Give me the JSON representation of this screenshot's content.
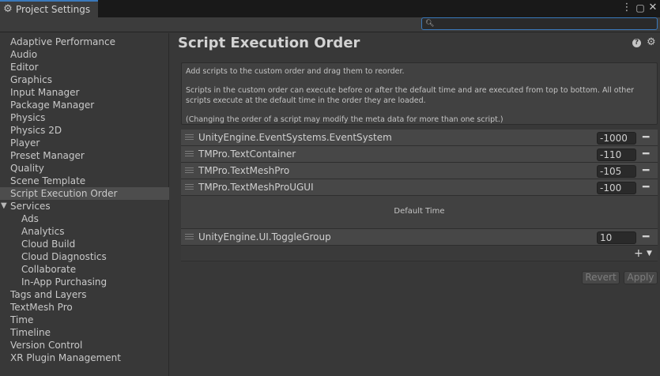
{
  "window": {
    "tab_title": "Project Settings",
    "controls": [
      "kebab-menu",
      "maximize",
      "close"
    ]
  },
  "search": {
    "value": "",
    "placeholder": ""
  },
  "sidebar": {
    "items": [
      {
        "label": "Adaptive Performance"
      },
      {
        "label": "Audio"
      },
      {
        "label": "Editor"
      },
      {
        "label": "Graphics"
      },
      {
        "label": "Input Manager"
      },
      {
        "label": "Package Manager"
      },
      {
        "label": "Physics"
      },
      {
        "label": "Physics 2D"
      },
      {
        "label": "Player"
      },
      {
        "label": "Preset Manager"
      },
      {
        "label": "Quality"
      },
      {
        "label": "Scene Template"
      },
      {
        "label": "Script Execution Order",
        "selected": true
      },
      {
        "label": "Services",
        "expanded": true
      },
      {
        "label": "Ads",
        "child": true
      },
      {
        "label": "Analytics",
        "child": true
      },
      {
        "label": "Cloud Build",
        "child": true
      },
      {
        "label": "Cloud Diagnostics",
        "child": true
      },
      {
        "label": "Collaborate",
        "child": true
      },
      {
        "label": "In-App Purchasing",
        "child": true
      },
      {
        "label": "Tags and Layers"
      },
      {
        "label": "TextMesh Pro"
      },
      {
        "label": "Time"
      },
      {
        "label": "Timeline"
      },
      {
        "label": "Version Control"
      },
      {
        "label": "XR Plugin Management"
      }
    ]
  },
  "main": {
    "title": "Script Execution Order",
    "info": {
      "line1": "Add scripts to the custom order and drag them to reorder.",
      "line2": "Scripts in the custom order can execute before or after the default time and are executed from top to bottom. All other scripts execute at the default time in the order they are loaded.",
      "line3": "(Changing the order of a script may modify the meta data for more than one script.)"
    },
    "scripts_before": [
      {
        "name": "UnityEngine.EventSystems.EventSystem",
        "order": "-1000"
      },
      {
        "name": "TMPro.TextContainer",
        "order": "-110"
      },
      {
        "name": "TMPro.TextMeshPro",
        "order": "-105"
      },
      {
        "name": "TMPro.TextMeshProUGUI",
        "order": "-100"
      }
    ],
    "default_time_label": "Default Time",
    "scripts_after": [
      {
        "name": "UnityEngine.UI.ToggleGroup",
        "order": "10"
      }
    ],
    "revert_label": "Revert",
    "apply_label": "Apply"
  }
}
